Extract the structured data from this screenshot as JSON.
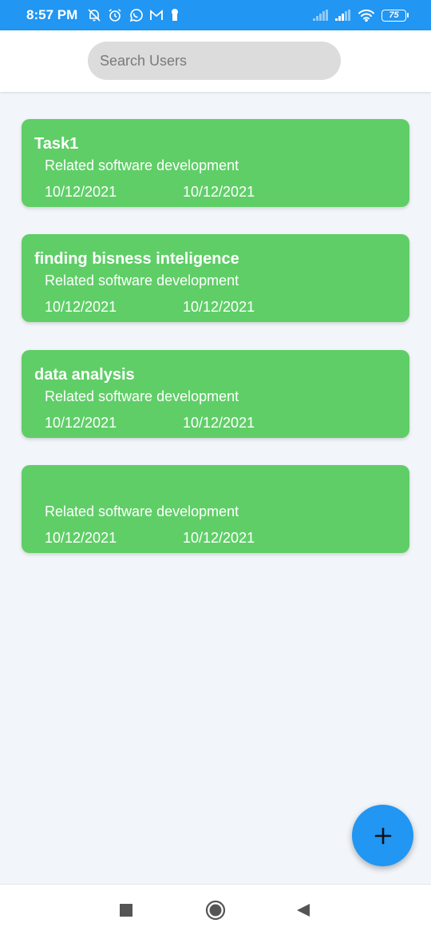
{
  "status_bar": {
    "time": "8:57 PM",
    "battery_level": "75",
    "left_icons": [
      "alarm-off-icon",
      "alarm-clock-icon",
      "whatsapp-icon",
      "gmail-icon",
      "keyhole-icon"
    ],
    "right_icons": [
      "signal-icon",
      "signal-icon",
      "wifi-icon",
      "battery-icon"
    ]
  },
  "search": {
    "placeholder": "Search Users",
    "value": ""
  },
  "tasks": [
    {
      "title": "Task1",
      "description": "Related software development",
      "start_date": "10/12/2021",
      "end_date": "10/12/2021"
    },
    {
      "title": "finding bisness inteligence",
      "description": "Related software development",
      "start_date": "10/12/2021",
      "end_date": "10/12/2021"
    },
    {
      "title": "data analysis",
      "description": "Related software development",
      "start_date": "10/12/2021",
      "end_date": "10/12/2021"
    },
    {
      "title": "",
      "description": "Related software development",
      "start_date": "10/12/2021",
      "end_date": "10/12/2021"
    }
  ],
  "fab": {
    "icon": "plus-icon"
  },
  "nav_bar": {
    "buttons": [
      "recent-apps-icon",
      "home-icon",
      "back-icon"
    ]
  },
  "colors": {
    "accent": "#2196f3",
    "card": "#5fce67",
    "background": "#f2f5f9",
    "search_bg": "#dcdcdc"
  }
}
